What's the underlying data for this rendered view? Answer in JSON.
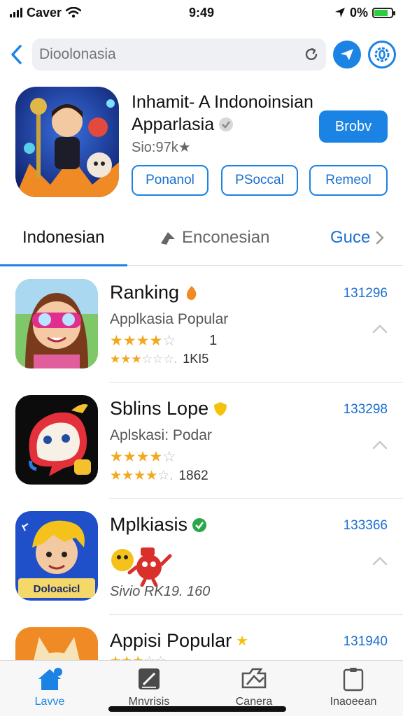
{
  "status_bar": {
    "carrier": "Caver",
    "time": "9:49",
    "battery_text": "0%",
    "battery_level": 0.8
  },
  "search": {
    "placeholder": "Dioolonasia"
  },
  "app": {
    "title_line1": "Inhamit- A Indonoinsian",
    "title_line2": "Apparlasia",
    "subtitle": "Sio:97k★",
    "get_label": "Brobv",
    "pills": [
      "Ponanol",
      "PSoccal",
      "Remeol"
    ]
  },
  "tabs": {
    "active": "Indonesian",
    "second": "Enconesian",
    "more": "Guce"
  },
  "list": [
    {
      "title": "Ranking",
      "subtitle": "Applkasia Popular",
      "stars1": 4,
      "stars1_text": "1",
      "stars2": 3,
      "stars2_text": "1KI5",
      "number": "131296",
      "badge_color": "#f08a24"
    },
    {
      "title": "Sblins Lope",
      "subtitle": "Aplskasi: Podar",
      "stars1": 4,
      "stars1_text": "",
      "stars2": 4,
      "stars2_text": "1862",
      "number": "133298",
      "badge_color": "#f4c20d"
    },
    {
      "title": "Mplkiasis",
      "subtitle": "",
      "stars1": 0,
      "stars1_text": "",
      "stars2": 0,
      "stars2_text": "Sivio RK19. 160",
      "number": "133366",
      "badge_color": "#2ca64a"
    },
    {
      "title": "Appisi Popular",
      "subtitle": "",
      "stars1": 3,
      "stars1_text": "",
      "stars2": 0,
      "stars2_text": "",
      "number": "131940",
      "badge_color": "#f4c20d"
    }
  ],
  "row3_icon_label": "Doloacicl",
  "tab_bar": [
    {
      "label": "Lavve",
      "icon": "home-icon"
    },
    {
      "label": "Mnvrisis",
      "icon": "edit-icon"
    },
    {
      "label": "Canera",
      "icon": "camera-icon"
    },
    {
      "label": "Inaoeean",
      "icon": "clipboard-icon"
    }
  ],
  "colors": {
    "accent": "#1a83e4",
    "star": "#f2a81d"
  }
}
